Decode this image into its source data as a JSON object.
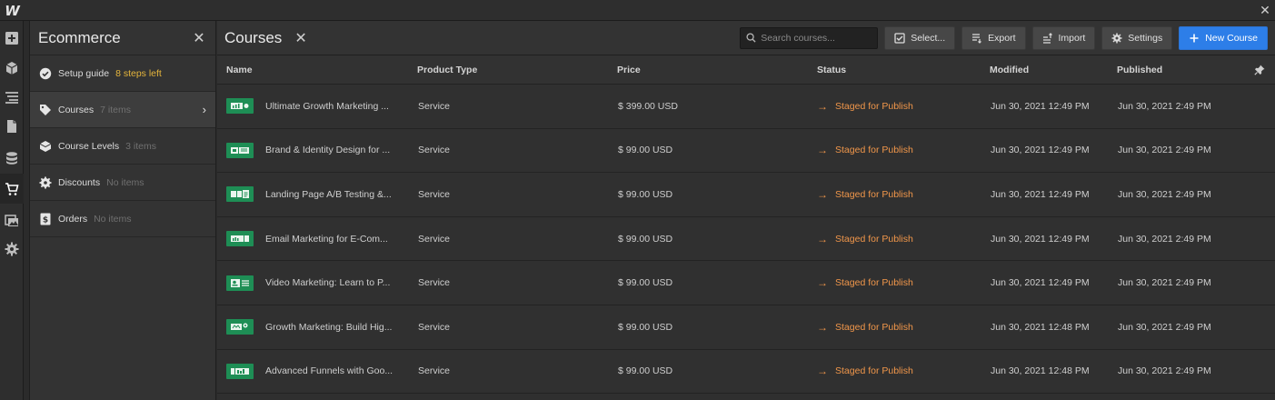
{
  "app": {
    "logo": "W",
    "close_glyph": "✕"
  },
  "panel": {
    "title": "Ecommerce",
    "items": [
      {
        "label": "Setup guide",
        "note": "8 steps left",
        "icon": "check-circle-icon"
      },
      {
        "label": "Courses",
        "note": "7 items",
        "icon": "tag-icon"
      },
      {
        "label": "Course Levels",
        "note": "3 items",
        "icon": "layers-icon"
      },
      {
        "label": "Discounts",
        "note": "No items",
        "icon": "badge-icon"
      },
      {
        "label": "Orders",
        "note": "No items",
        "icon": "dollar-icon"
      }
    ]
  },
  "main": {
    "title": "Courses",
    "search_placeholder": "Search courses...",
    "buttons": {
      "select": "Select...",
      "export": "Export",
      "import": "Import",
      "settings": "Settings",
      "new_course": "New Course"
    },
    "columns": [
      "Name",
      "Product Type",
      "Price",
      "Status",
      "Modified",
      "Published"
    ],
    "rows": [
      {
        "name": "Ultimate Growth Marketing ...",
        "type": "Service",
        "price": "$ 399.00 USD",
        "status": "Staged for Publish",
        "modified": "Jun 30, 2021 12:49 PM",
        "published": "Jun 30, 2021 2:49 PM"
      },
      {
        "name": "Brand & Identity Design for ...",
        "type": "Service",
        "price": "$ 99.00 USD",
        "status": "Staged for Publish",
        "modified": "Jun 30, 2021 12:49 PM",
        "published": "Jun 30, 2021 2:49 PM"
      },
      {
        "name": "Landing Page A/B Testing &...",
        "type": "Service",
        "price": "$ 99.00 USD",
        "status": "Staged for Publish",
        "modified": "Jun 30, 2021 12:49 PM",
        "published": "Jun 30, 2021 2:49 PM"
      },
      {
        "name": "Email Marketing for E-Com...",
        "type": "Service",
        "price": "$ 99.00 USD",
        "status": "Staged for Publish",
        "modified": "Jun 30, 2021 12:49 PM",
        "published": "Jun 30, 2021 2:49 PM"
      },
      {
        "name": "Video Marketing: Learn to P...",
        "type": "Service",
        "price": "$ 99.00 USD",
        "status": "Staged for Publish",
        "modified": "Jun 30, 2021 12:49 PM",
        "published": "Jun 30, 2021 2:49 PM"
      },
      {
        "name": "Growth Marketing: Build Hig...",
        "type": "Service",
        "price": "$ 99.00 USD",
        "status": "Staged for Publish",
        "modified": "Jun 30, 2021 12:48 PM",
        "published": "Jun 30, 2021 2:49 PM"
      },
      {
        "name": "Advanced Funnels with Goo...",
        "type": "Service",
        "price": "$ 99.00 USD",
        "status": "Staged for Publish",
        "modified": "Jun 30, 2021 12:48 PM",
        "published": "Jun 30, 2021 2:49 PM"
      }
    ]
  },
  "colors": {
    "accent": "#2d7ee8",
    "status": "#f0964a",
    "warning": "#e5b53c",
    "thumb": "#1e8e55"
  }
}
